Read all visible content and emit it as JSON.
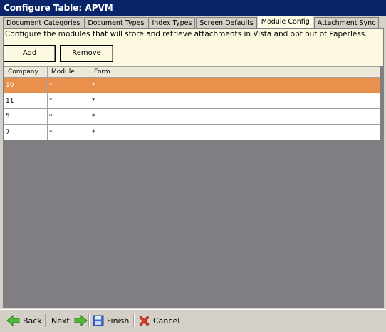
{
  "window": {
    "title": "Configure Table: APVM"
  },
  "tabs": [
    {
      "label": "Document Categories"
    },
    {
      "label": "Document Types"
    },
    {
      "label": "Index Types"
    },
    {
      "label": "Screen Defaults"
    },
    {
      "label": "Module Config"
    },
    {
      "label": "Attachment Sync"
    }
  ],
  "active_tab": "Module Config",
  "panel": {
    "description": "Configure the modules that will store and retrieve attachments in Vista and opt out of Paperless.",
    "add_label": "Add",
    "remove_label": "Remove"
  },
  "grid": {
    "columns": [
      "Company",
      "Module",
      "Form"
    ],
    "rows": [
      {
        "company": "10",
        "module": "*",
        "form": "*",
        "selected": true
      },
      {
        "company": "11",
        "module": "*",
        "form": "*",
        "selected": false
      },
      {
        "company": "5",
        "module": "*",
        "form": "*",
        "selected": false
      },
      {
        "company": "7",
        "module": "*",
        "form": "*",
        "selected": false
      }
    ],
    "selected_color": "#e8904c"
  },
  "footer": {
    "back_label": "Back",
    "next_label": "Next",
    "finish_label": "Finish",
    "cancel_label": "Cancel",
    "icons": [
      "arrow-left-icon",
      "arrow-right-icon",
      "floppy-disk-icon",
      "cancel-x-icon"
    ]
  }
}
